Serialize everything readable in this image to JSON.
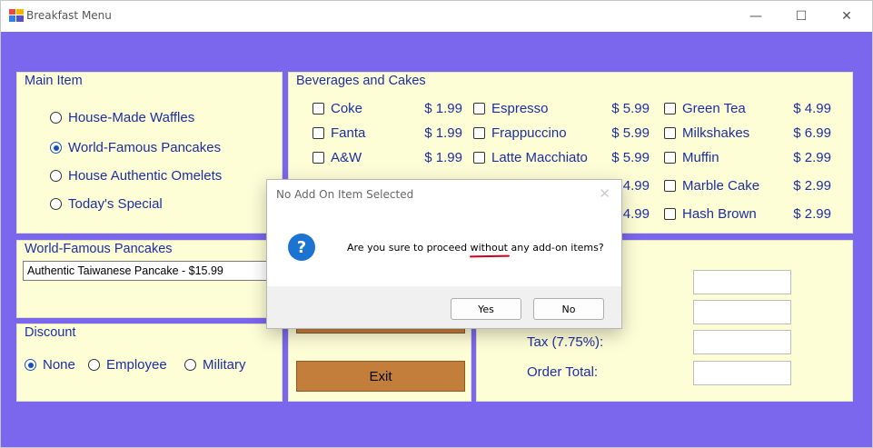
{
  "window": {
    "title": "Breakfast Menu",
    "minimize": "—",
    "maximize": "☐",
    "close": "✕"
  },
  "main_item": {
    "title": "Main Item",
    "options": [
      {
        "label": "House-Made Waffles",
        "selected": false
      },
      {
        "label": "World-Famous Pancakes",
        "selected": true
      },
      {
        "label": "House Authentic Omelets",
        "selected": false
      },
      {
        "label": "Today's Special",
        "selected": false
      }
    ]
  },
  "beverages": {
    "title": "Beverages and Cakes",
    "col1": [
      {
        "label": "Coke",
        "price": "$ 1.99"
      },
      {
        "label": "Fanta",
        "price": "$ 1.99"
      },
      {
        "label": "A&W",
        "price": "$ 1.99"
      }
    ],
    "col2": [
      {
        "label": "Espresso",
        "price": "$ 5.99"
      },
      {
        "label": "Frappuccino",
        "price": "$ 5.99"
      },
      {
        "label": "Latte Macchiato",
        "price": "$ 5.99"
      }
    ],
    "col2_hidden_prices": [
      "4.99",
      "4.99"
    ],
    "col3": [
      {
        "label": "Green Tea",
        "price": "$ 4.99"
      },
      {
        "label": "Milkshakes",
        "price": "$ 6.99"
      },
      {
        "label": "Muffin",
        "price": "$ 2.99"
      },
      {
        "label": "Marble Cake",
        "price": "$ 2.99"
      },
      {
        "label": "Hash Brown",
        "price": "$ 2.99"
      }
    ]
  },
  "pancakes": {
    "title": "World-Famous Pancakes",
    "selected": "Authentic Taiwanese Pancake - $15.99"
  },
  "discount": {
    "title": "Discount",
    "options": [
      {
        "label": "None",
        "selected": true
      },
      {
        "label": "Employee",
        "selected": false
      },
      {
        "label": "Military",
        "selected": false
      }
    ]
  },
  "actions": {
    "exit_label": "Exit"
  },
  "totals": {
    "tax_label": "Tax (7.75%):",
    "order_total_label": "Order Total:"
  },
  "dialog": {
    "title": "No Add On Item Selected",
    "msg_before": "Are you sure to proceed ",
    "msg_emph": "without",
    "msg_after": " any add-on items?",
    "yes": "Yes",
    "no": "No",
    "close": "✕",
    "icon_glyph": "?"
  },
  "colors": {
    "background": "#7b66ee",
    "panel": "#fdfdd6",
    "label_text": "#1d2fa0",
    "button": "#c47e3c",
    "question_icon": "#1c74d2",
    "underline": "#d0021b"
  }
}
